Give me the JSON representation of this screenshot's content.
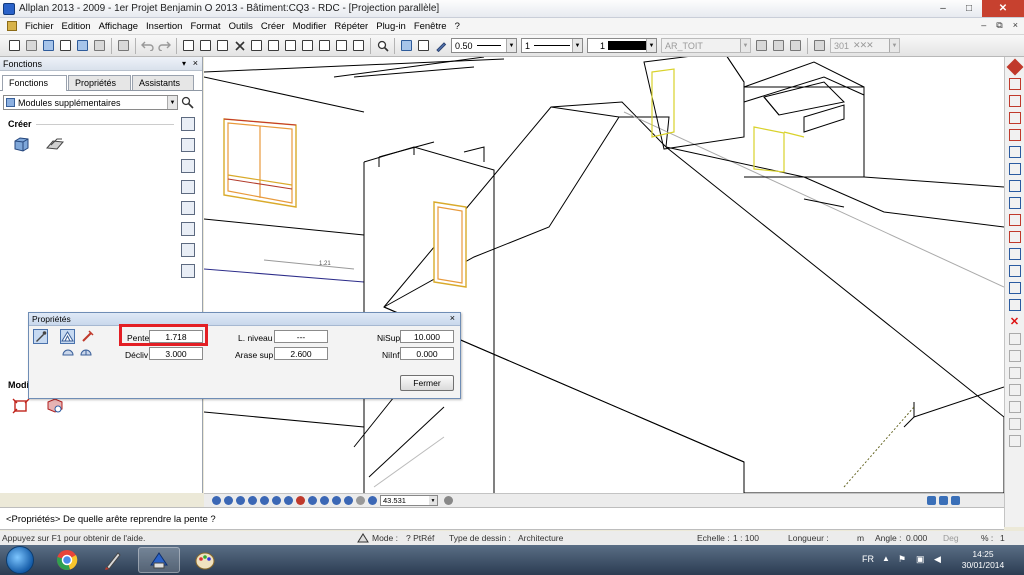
{
  "window": {
    "title": "Allplan 2013 - 2009 - 1er Projet Benjamin O 2013 - Bâtiment:CQ3 - RDC - [Projection parallèle]",
    "minimize": "–",
    "maximize": "□",
    "close": "✕"
  },
  "menu": {
    "items": [
      "Fichier",
      "Edition",
      "Affichage",
      "Insertion",
      "Format",
      "Outils",
      "Créer",
      "Modifier",
      "Répéter",
      "Plug-in",
      "Fenêtre",
      "?"
    ],
    "mdi_minimize": "–",
    "mdi_restore": "⧉",
    "mdi_close": "×"
  },
  "toolbar": {
    "pen_thickness": "0.50",
    "line_type": "1",
    "color": "1",
    "layer": "AR_TOIT",
    "hatch": "301"
  },
  "left_panel": {
    "title": "Fonctions",
    "pin": "▾",
    "close": "×",
    "tabs": [
      "Fonctions",
      "Propriétés",
      "Assistants"
    ],
    "module_combo": "Modules supplémentaires",
    "group_creer": "Créer",
    "group_modifier": "Modi"
  },
  "properties_dialog": {
    "title": "Propriétés",
    "close": "×",
    "pente_label": "Pente",
    "pente_value": "1.718",
    "decliv_label": "Décliv",
    "decliv_value": "3.000",
    "l_niveau_label": "L. niveau",
    "l_niveau_value": "---",
    "arase_label": "Arase sup.",
    "arase_value": "2.600",
    "nisup_label": "NiSup",
    "nisup_value": "10.000",
    "niinf_label": "NiInf",
    "niinf_value": "0.000",
    "close_button": "Fermer"
  },
  "viewport": {
    "dimension_label": "1.21"
  },
  "viewport_toolbar": {
    "zoom_value": "43.531"
  },
  "prompt": {
    "text": "<Propriétés> De quelle arête reprendre la pente ?"
  },
  "statusbar": {
    "help": "Appuyez sur F1 pour obtenir de l'aide.",
    "mode_label": "Mode :",
    "mode_value": "? PtRéf",
    "drawing_type_label": "Type de dessin :",
    "drawing_type_value": "Architecture",
    "scale_label": "Echelle :",
    "scale_value": "1 : 100",
    "length_label": "Longueur :",
    "length_value": "m",
    "angle_label": "Angle :",
    "angle_value": "0.000",
    "deg": "Deg",
    "percent_label": "% :",
    "percent_value": "1"
  },
  "taskbar": {
    "language": "FR",
    "time": "14:25",
    "date": "30/01/2014"
  },
  "colors": {
    "highlight_box": "#e31e24",
    "window_frame": "#d9aa2b",
    "window_frame_inner": "#e89a3c"
  }
}
